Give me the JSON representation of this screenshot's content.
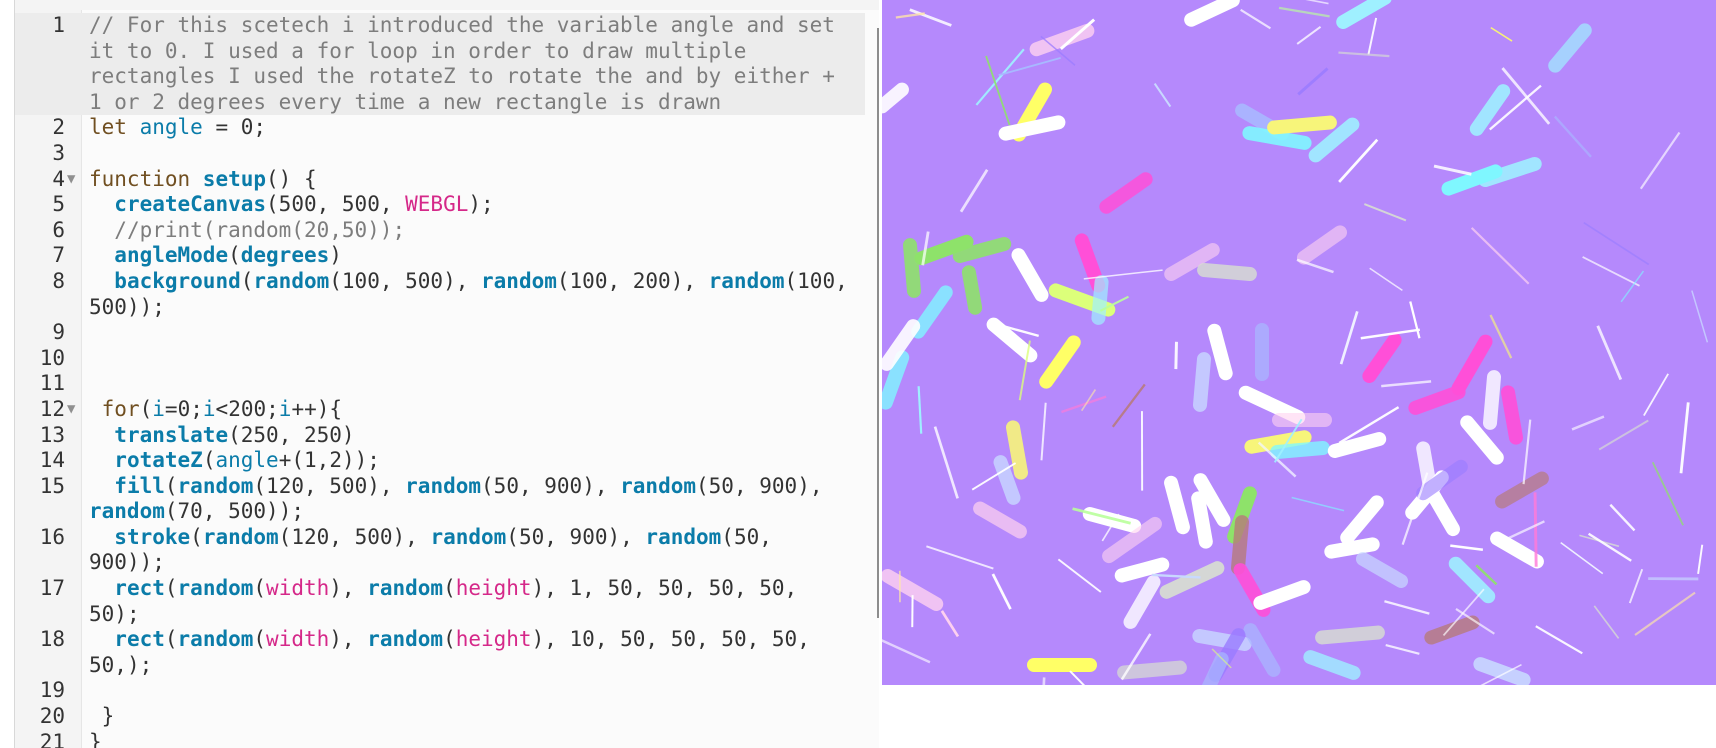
{
  "editor": {
    "lines": [
      {
        "n": "1",
        "fold": false,
        "active": true,
        "tokens": [
          {
            "c": "comment",
            "t": "// For this scetech i introduced the variable angle and set it to 0. I used a for loop in order to draw multiple rectangles I used the rotateZ to rotate the and by either + 1 or 2 degrees every time a new rectangle is drawn"
          }
        ]
      },
      {
        "n": "2",
        "fold": false,
        "tokens": [
          {
            "c": "keyword",
            "t": "let "
          },
          {
            "c": "def",
            "t": "angle"
          },
          {
            "c": "op",
            "t": " = "
          },
          {
            "c": "number",
            "t": "0"
          },
          {
            "c": "plain",
            "t": ";"
          }
        ]
      },
      {
        "n": "3",
        "fold": false,
        "tokens": []
      },
      {
        "n": "4",
        "fold": true,
        "tokens": [
          {
            "c": "keyword",
            "t": "function "
          },
          {
            "c": "builtin",
            "t": "setup"
          },
          {
            "c": "plain",
            "t": "() {"
          }
        ]
      },
      {
        "n": "5",
        "fold": false,
        "tokens": [
          {
            "c": "plain",
            "t": "  "
          },
          {
            "c": "builtin",
            "t": "createCanvas"
          },
          {
            "c": "plain",
            "t": "("
          },
          {
            "c": "number",
            "t": "500"
          },
          {
            "c": "plain",
            "t": ", "
          },
          {
            "c": "number",
            "t": "500"
          },
          {
            "c": "plain",
            "t": ", "
          },
          {
            "c": "const",
            "t": "WEBGL"
          },
          {
            "c": "plain",
            "t": ");"
          }
        ]
      },
      {
        "n": "6",
        "fold": false,
        "tokens": [
          {
            "c": "plain",
            "t": "  "
          },
          {
            "c": "comment",
            "t": "//print(random(20,50));"
          }
        ]
      },
      {
        "n": "7",
        "fold": false,
        "tokens": [
          {
            "c": "plain",
            "t": "  "
          },
          {
            "c": "builtin",
            "t": "angleMode"
          },
          {
            "c": "plain",
            "t": "("
          },
          {
            "c": "builtin",
            "t": "degrees"
          },
          {
            "c": "plain",
            "t": ")"
          }
        ]
      },
      {
        "n": "8",
        "fold": false,
        "tokens": [
          {
            "c": "plain",
            "t": "  "
          },
          {
            "c": "builtin",
            "t": "background"
          },
          {
            "c": "plain",
            "t": "("
          },
          {
            "c": "builtin",
            "t": "random"
          },
          {
            "c": "plain",
            "t": "("
          },
          {
            "c": "number",
            "t": "100"
          },
          {
            "c": "plain",
            "t": ", "
          },
          {
            "c": "number",
            "t": "500"
          },
          {
            "c": "plain",
            "t": "), "
          },
          {
            "c": "builtin",
            "t": "random"
          },
          {
            "c": "plain",
            "t": "("
          },
          {
            "c": "number",
            "t": "100"
          },
          {
            "c": "plain",
            "t": ", "
          },
          {
            "c": "number",
            "t": "200"
          },
          {
            "c": "plain",
            "t": "), "
          },
          {
            "c": "builtin",
            "t": "random"
          },
          {
            "c": "plain",
            "t": "("
          },
          {
            "c": "number",
            "t": "100"
          },
          {
            "c": "plain",
            "t": ", "
          },
          {
            "c": "number",
            "t": "500"
          },
          {
            "c": "plain",
            "t": "));"
          }
        ]
      },
      {
        "n": "9",
        "fold": false,
        "tokens": []
      },
      {
        "n": "10",
        "fold": false,
        "tokens": []
      },
      {
        "n": "11",
        "fold": false,
        "tokens": []
      },
      {
        "n": "12",
        "fold": true,
        "tokens": [
          {
            "c": "plain",
            "t": " "
          },
          {
            "c": "keyword",
            "t": "for"
          },
          {
            "c": "plain",
            "t": "("
          },
          {
            "c": "def",
            "t": "i"
          },
          {
            "c": "op",
            "t": "="
          },
          {
            "c": "number",
            "t": "0"
          },
          {
            "c": "plain",
            "t": ";"
          },
          {
            "c": "def",
            "t": "i"
          },
          {
            "c": "op",
            "t": "<"
          },
          {
            "c": "number",
            "t": "200"
          },
          {
            "c": "plain",
            "t": ";"
          },
          {
            "c": "def",
            "t": "i"
          },
          {
            "c": "op",
            "t": "++"
          },
          {
            "c": "plain",
            "t": "){"
          }
        ]
      },
      {
        "n": "13",
        "fold": false,
        "tokens": [
          {
            "c": "plain",
            "t": "  "
          },
          {
            "c": "builtin",
            "t": "translate"
          },
          {
            "c": "plain",
            "t": "("
          },
          {
            "c": "number",
            "t": "250"
          },
          {
            "c": "plain",
            "t": ", "
          },
          {
            "c": "number",
            "t": "250"
          },
          {
            "c": "plain",
            "t": ")"
          }
        ]
      },
      {
        "n": "14",
        "fold": false,
        "tokens": [
          {
            "c": "plain",
            "t": "  "
          },
          {
            "c": "builtin",
            "t": "rotateZ"
          },
          {
            "c": "plain",
            "t": "("
          },
          {
            "c": "def",
            "t": "angle"
          },
          {
            "c": "op",
            "t": "+"
          },
          {
            "c": "plain",
            "t": "("
          },
          {
            "c": "number",
            "t": "1"
          },
          {
            "c": "plain",
            "t": ","
          },
          {
            "c": "number",
            "t": "2"
          },
          {
            "c": "plain",
            "t": "));"
          }
        ]
      },
      {
        "n": "15",
        "fold": false,
        "tokens": [
          {
            "c": "plain",
            "t": "  "
          },
          {
            "c": "builtin",
            "t": "fill"
          },
          {
            "c": "plain",
            "t": "("
          },
          {
            "c": "builtin",
            "t": "random"
          },
          {
            "c": "plain",
            "t": "("
          },
          {
            "c": "number",
            "t": "120"
          },
          {
            "c": "plain",
            "t": ", "
          },
          {
            "c": "number",
            "t": "500"
          },
          {
            "c": "plain",
            "t": "), "
          },
          {
            "c": "builtin",
            "t": "random"
          },
          {
            "c": "plain",
            "t": "("
          },
          {
            "c": "number",
            "t": "50"
          },
          {
            "c": "plain",
            "t": ", "
          },
          {
            "c": "number",
            "t": "900"
          },
          {
            "c": "plain",
            "t": "), "
          },
          {
            "c": "builtin",
            "t": "random"
          },
          {
            "c": "plain",
            "t": "("
          },
          {
            "c": "number",
            "t": "50"
          },
          {
            "c": "plain",
            "t": ", "
          },
          {
            "c": "number",
            "t": "900"
          },
          {
            "c": "plain",
            "t": "), "
          },
          {
            "c": "builtin",
            "t": "random"
          },
          {
            "c": "plain",
            "t": "("
          },
          {
            "c": "number",
            "t": "70"
          },
          {
            "c": "plain",
            "t": ", "
          },
          {
            "c": "number",
            "t": "500"
          },
          {
            "c": "plain",
            "t": "));"
          }
        ]
      },
      {
        "n": "16",
        "fold": false,
        "tokens": [
          {
            "c": "plain",
            "t": "  "
          },
          {
            "c": "builtin",
            "t": "stroke"
          },
          {
            "c": "plain",
            "t": "("
          },
          {
            "c": "builtin",
            "t": "random"
          },
          {
            "c": "plain",
            "t": "("
          },
          {
            "c": "number",
            "t": "120"
          },
          {
            "c": "plain",
            "t": ", "
          },
          {
            "c": "number",
            "t": "500"
          },
          {
            "c": "plain",
            "t": "), "
          },
          {
            "c": "builtin",
            "t": "random"
          },
          {
            "c": "plain",
            "t": "("
          },
          {
            "c": "number",
            "t": "50"
          },
          {
            "c": "plain",
            "t": ", "
          },
          {
            "c": "number",
            "t": "900"
          },
          {
            "c": "plain",
            "t": "), "
          },
          {
            "c": "builtin",
            "t": "random"
          },
          {
            "c": "plain",
            "t": "("
          },
          {
            "c": "number",
            "t": "50"
          },
          {
            "c": "plain",
            "t": ", "
          },
          {
            "c": "number",
            "t": "900"
          },
          {
            "c": "plain",
            "t": "));"
          }
        ]
      },
      {
        "n": "17",
        "fold": false,
        "tokens": [
          {
            "c": "plain",
            "t": "  "
          },
          {
            "c": "builtin",
            "t": "rect"
          },
          {
            "c": "plain",
            "t": "("
          },
          {
            "c": "builtin",
            "t": "random"
          },
          {
            "c": "plain",
            "t": "("
          },
          {
            "c": "const",
            "t": "width"
          },
          {
            "c": "plain",
            "t": "), "
          },
          {
            "c": "builtin",
            "t": "random"
          },
          {
            "c": "plain",
            "t": "("
          },
          {
            "c": "const",
            "t": "height"
          },
          {
            "c": "plain",
            "t": "), "
          },
          {
            "c": "number",
            "t": "1"
          },
          {
            "c": "plain",
            "t": ", "
          },
          {
            "c": "number",
            "t": "50"
          },
          {
            "c": "plain",
            "t": ", "
          },
          {
            "c": "number",
            "t": "50"
          },
          {
            "c": "plain",
            "t": ", "
          },
          {
            "c": "number",
            "t": "50"
          },
          {
            "c": "plain",
            "t": ", "
          },
          {
            "c": "number",
            "t": "50"
          },
          {
            "c": "plain",
            "t": ", "
          },
          {
            "c": "number",
            "t": "50"
          },
          {
            "c": "plain",
            "t": ");"
          }
        ]
      },
      {
        "n": "18",
        "fold": false,
        "tokens": [
          {
            "c": "plain",
            "t": "  "
          },
          {
            "c": "builtin",
            "t": "rect"
          },
          {
            "c": "plain",
            "t": "("
          },
          {
            "c": "builtin",
            "t": "random"
          },
          {
            "c": "plain",
            "t": "("
          },
          {
            "c": "const",
            "t": "width"
          },
          {
            "c": "plain",
            "t": "), "
          },
          {
            "c": "builtin",
            "t": "random"
          },
          {
            "c": "plain",
            "t": "("
          },
          {
            "c": "const",
            "t": "height"
          },
          {
            "c": "plain",
            "t": "), "
          },
          {
            "c": "number",
            "t": "10"
          },
          {
            "c": "plain",
            "t": ", "
          },
          {
            "c": "number",
            "t": "50"
          },
          {
            "c": "plain",
            "t": ", "
          },
          {
            "c": "number",
            "t": "50"
          },
          {
            "c": "plain",
            "t": ", "
          },
          {
            "c": "number",
            "t": "50"
          },
          {
            "c": "plain",
            "t": ", "
          },
          {
            "c": "number",
            "t": "50"
          },
          {
            "c": "plain",
            "t": ", "
          },
          {
            "c": "number",
            "t": "50"
          },
          {
            "c": "plain",
            "t": ",);"
          }
        ]
      },
      {
        "n": "19",
        "fold": false,
        "tokens": []
      },
      {
        "n": "20",
        "fold": false,
        "tokens": [
          {
            "c": "plain",
            "t": " }"
          }
        ]
      },
      {
        "n": "21",
        "fold": false,
        "tokens": [
          {
            "c": "plain",
            "t": "}"
          }
        ]
      }
    ]
  },
  "sketch": {
    "background": "#b589fc",
    "palette": [
      "#ffffff",
      "#f2f5ff",
      "#ff4fd8",
      "#ff7ad9",
      "#ffff66",
      "#f7f57a",
      "#dcff7a",
      "#8ee26a",
      "#b9ff9a",
      "#7ff7ff",
      "#9ff0ff",
      "#c8d8ff",
      "#a8b8ff",
      "#9a7cff",
      "#d2a8ff",
      "#ffd2f0",
      "#b77a7a",
      "#d8e0d0",
      "#ffe6a6"
    ]
  }
}
